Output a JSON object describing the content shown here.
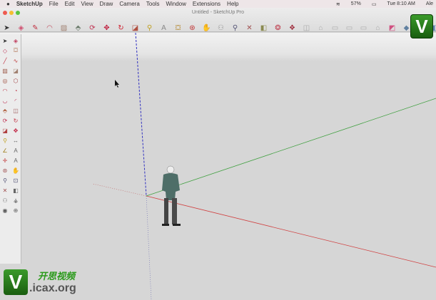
{
  "menubar": {
    "app": "SketchUp",
    "items": [
      "File",
      "Edit",
      "View",
      "Draw",
      "Camera",
      "Tools",
      "Window",
      "Extensions",
      "Help"
    ],
    "battery": "57%",
    "clock": "Tue 8:10 AM",
    "user": "Ale"
  },
  "window": {
    "title": "Untitled - SketchUp Pro"
  },
  "toolbar": {
    "tools": [
      "select",
      "eraser",
      "pencil",
      "arc",
      "rectangle",
      "push-pull",
      "follow-me",
      "move",
      "rotate",
      "scale",
      "tape-measure",
      "text",
      "paint-bucket",
      "orbit",
      "pan",
      "walk",
      "zoom",
      "zoom-extents",
      "previous-view",
      "3d-warehouse",
      "components",
      "iso",
      "top",
      "front",
      "right",
      "back",
      "left",
      "styles",
      "section",
      "position-camera",
      "layers"
    ]
  },
  "palette": {
    "tools": [
      "select",
      "make-component",
      "eraser",
      "paint",
      "pencil",
      "freehand",
      "rectangle",
      "rotated-rectangle",
      "circle",
      "polygon",
      "arc",
      "pie",
      "3-point-arc",
      "2-point-arc",
      "push-pull",
      "offset",
      "follow-me",
      "rotate",
      "scale",
      "move",
      "tape-measure",
      "dimensions",
      "protractor",
      "text",
      "axes",
      "3d-text",
      "orbit",
      "pan",
      "zoom",
      "zoom-window",
      "zoom-extents",
      "previous",
      "position-camera",
      "walk",
      "look-around",
      "section-plane"
    ]
  },
  "watermark": {
    "letter": "V",
    "cn": "开思视频",
    "url": ".icax.org"
  },
  "logo": {
    "letter": "V"
  },
  "colors": {
    "x_axis": "#d04040",
    "y_axis": "#40a040",
    "z_axis": "#3030c0"
  }
}
